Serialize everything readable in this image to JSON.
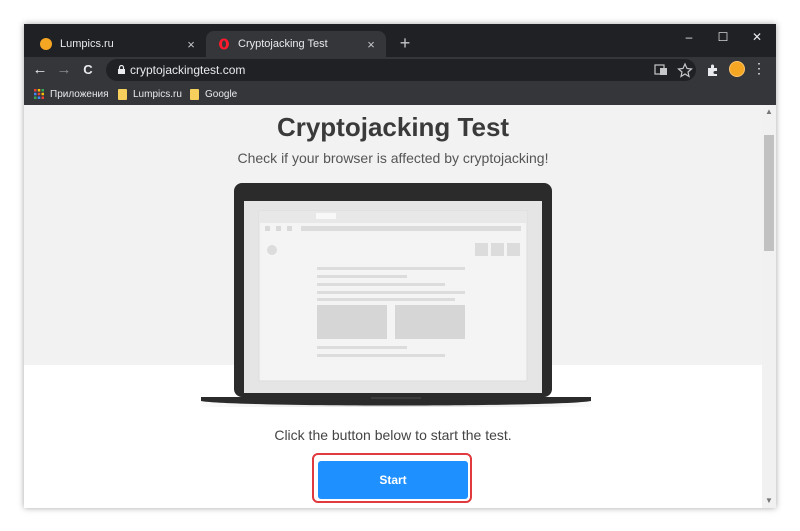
{
  "tabs": [
    {
      "title": "Lumpics.ru",
      "close": "×",
      "active": false
    },
    {
      "title": "Cryptojacking Test",
      "close": "×",
      "active": true
    }
  ],
  "new_tab": "+",
  "window_controls": {
    "minimize": "–",
    "maximize": "☐",
    "close": "✕"
  },
  "nav": {
    "back": "←",
    "forward": "→",
    "reload": "C"
  },
  "address": {
    "url": "cryptojackingtest.com"
  },
  "toolbar_icons": [
    "translate-icon",
    "star-icon",
    "extensions-icon",
    "profile-avatar",
    "menu-icon"
  ],
  "menu_dots": "⋮",
  "bookmarks": [
    {
      "label": "Приложения",
      "icon": "apps-grid-icon"
    },
    {
      "label": "Lumpics.ru",
      "icon": "folder-icon"
    },
    {
      "label": "Google",
      "icon": "folder-icon"
    }
  ],
  "page": {
    "title": "Cryptojacking Test",
    "subtitle": "Check if your browser is affected by cryptojacking!",
    "instruction": "Click the button below to start the test.",
    "start_label": "Start"
  },
  "scrollbar": {
    "up": "▲",
    "down": "▼"
  },
  "colors": {
    "chrome_dark": "#202124",
    "toolbar": "#35363a",
    "start_button": "#1e90ff",
    "highlight": "#e0393e"
  }
}
